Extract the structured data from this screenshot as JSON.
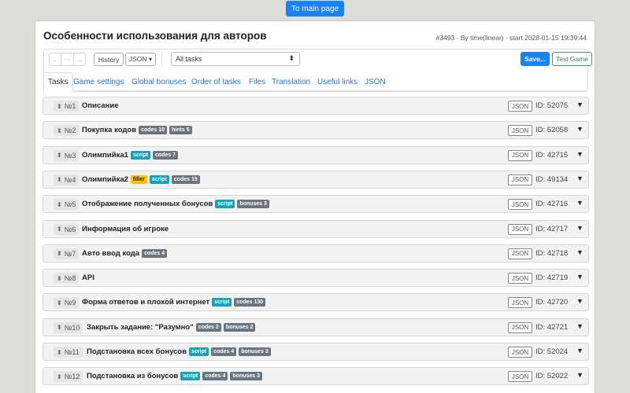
{
  "nav": {
    "main_page": "To main page"
  },
  "header": {
    "title": "Особенности использования для авторов",
    "meta": "#3493 · By time(linear) · start 2028-01-15 19:39:44"
  },
  "toolbar": {
    "undo_glyph": "←",
    "history_glyph": "⋯",
    "redo_glyph": "→",
    "history": "History",
    "json": "JSON ▾",
    "task_filter": "All tasks",
    "save": "Save...",
    "test_game": "Test Game"
  },
  "tabs": [
    "Tasks",
    "Game settings",
    "Global bonuses",
    "Order of tasks",
    "Files",
    "Translation",
    "Useful links",
    "JSON"
  ],
  "active_tab": "Tasks",
  "tasks": [
    {
      "num": "№1",
      "title": "Описание",
      "badges": [],
      "json": "JSON",
      "id": "ID: 52075"
    },
    {
      "num": "№2",
      "title": "Покупка кодов",
      "badges": [
        {
          "text": "codes 10",
          "color": "gray"
        },
        {
          "text": "hints 5",
          "color": "gray"
        }
      ],
      "json": "JSON",
      "id": "ID: 52058"
    },
    {
      "num": "№3",
      "title": "Олимпийка1",
      "badges": [
        {
          "text": "script",
          "color": "cyan"
        },
        {
          "text": "codes 7",
          "color": "gray"
        }
      ],
      "json": "JSON",
      "id": "ID: 42715"
    },
    {
      "num": "№4",
      "title": "Олимпийка2",
      "badges": [
        {
          "text": "filler",
          "color": "yellow"
        },
        {
          "text": "script",
          "color": "cyan"
        },
        {
          "text": "codes 15",
          "color": "gray"
        }
      ],
      "json": "JSON",
      "id": "ID: 49134"
    },
    {
      "num": "№5",
      "title": "Отображение полученных бонусов",
      "badges": [
        {
          "text": "script",
          "color": "cyan"
        },
        {
          "text": "bonuses 3",
          "color": "gray"
        }
      ],
      "json": "JSON",
      "id": "ID: 42716"
    },
    {
      "num": "№6",
      "title": "Информация об игроке",
      "badges": [],
      "json": "JSON",
      "id": "ID: 42717"
    },
    {
      "num": "№7",
      "title": "Авто ввод кода",
      "badges": [
        {
          "text": "codes 4",
          "color": "gray"
        }
      ],
      "json": "JSON",
      "id": "ID: 42718"
    },
    {
      "num": "№8",
      "title": "API",
      "badges": [],
      "json": "JSON",
      "id": "ID: 42719"
    },
    {
      "num": "№9",
      "title": "Форма ответов и плохой интернет",
      "badges": [
        {
          "text": "script",
          "color": "cyan"
        },
        {
          "text": "codes 130",
          "color": "gray"
        }
      ],
      "json": "JSON",
      "id": "ID: 42720"
    },
    {
      "num": "№10",
      "title": "Закрыть задание: \"Разумно\"",
      "badges": [
        {
          "text": "codes 2",
          "color": "gray"
        },
        {
          "text": "bonuses 2",
          "color": "gray"
        }
      ],
      "json": "JSON",
      "id": "ID: 42721"
    },
    {
      "num": "№11",
      "title": "Подстановка всех бонусов",
      "badges": [
        {
          "text": "script",
          "color": "cyan"
        },
        {
          "text": "codes 4",
          "color": "gray"
        },
        {
          "text": "bonuses 3",
          "color": "gray"
        }
      ],
      "json": "JSON",
      "id": "ID: 52024"
    },
    {
      "num": "№12",
      "title": "Подстановка из бонусов",
      "badges": [
        {
          "text": "script",
          "color": "cyan"
        },
        {
          "text": "codes 4",
          "color": "gray"
        },
        {
          "text": "bonuses 3",
          "color": "gray"
        }
      ],
      "json": "JSON",
      "id": "ID: 52022"
    }
  ],
  "icons": {
    "sort": "sort-icon",
    "expand": "caret-down-icon",
    "select_caret": "up-down-caret-icon"
  },
  "colors": {
    "primary": "#1a82f7",
    "success": "#3aa05a",
    "badge_gray": "#6c757d",
    "badge_cyan": "#17a2b8",
    "badge_yellow": "#ffc107"
  }
}
